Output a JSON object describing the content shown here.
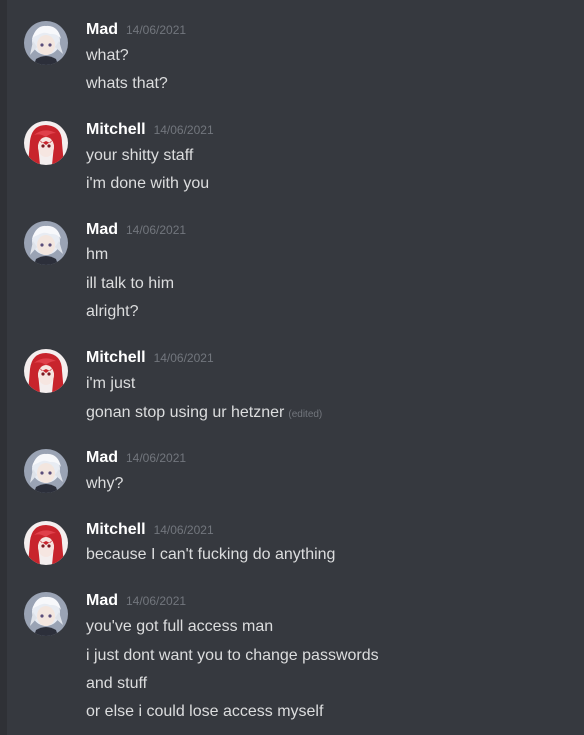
{
  "users": {
    "mad": {
      "name": "Mad",
      "avatar_icon": "white-haired-anime-avatar"
    },
    "mitchell": {
      "name": "Mitchell",
      "avatar_icon": "red-haired-anime-avatar"
    }
  },
  "messages": [
    {
      "author": "Mad",
      "timestamp": "14/06/2021",
      "lines": [
        "what?",
        "whats that?"
      ]
    },
    {
      "author": "Mitchell",
      "timestamp": "14/06/2021",
      "lines": [
        "your shitty staff",
        "i'm done with you"
      ]
    },
    {
      "author": "Mad",
      "timestamp": "14/06/2021",
      "lines": [
        "hm",
        "ill talk to him",
        "alright?"
      ]
    },
    {
      "author": "Mitchell",
      "timestamp": "14/06/2021",
      "lines": [
        "i'm just",
        "gonan stop using ur hetzner"
      ],
      "edited_label": "(edited)"
    },
    {
      "author": "Mad",
      "timestamp": "14/06/2021",
      "lines": [
        "why?"
      ]
    },
    {
      "author": "Mitchell",
      "timestamp": "14/06/2021",
      "lines": [
        "because I can't fucking do anything"
      ]
    },
    {
      "author": "Mad",
      "timestamp": "14/06/2021",
      "lines": [
        "you've got full access man",
        "i just dont want you to change passwords",
        "and stuff",
        "or else i could lose access myself"
      ]
    }
  ],
  "colors": {
    "background": "#36393f",
    "username": "#ffffff",
    "message_text": "#dcddde",
    "timestamp": "#72767d"
  }
}
